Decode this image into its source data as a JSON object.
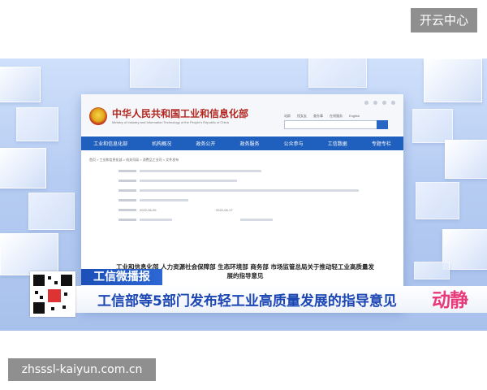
{
  "badge": {
    "label": "开云中心"
  },
  "document": {
    "ministry_title": "中华人民共和国工业和信息化部",
    "ministry_subtitle": "Ministry of Industry and Information Technology of the People's Republic of China",
    "top_links": [
      "站群",
      "找女友",
      "查办事",
      "在线服务",
      "English"
    ],
    "nav": [
      "工业和信息化部",
      "机构概况",
      "政务公开",
      "政务服务",
      "公众参与",
      "工信数据",
      "专题专栏"
    ],
    "breadcrumb": "首页 > 工业和信息化部 > 机关司局 > 消费品工业司 > 文件发布",
    "date_issued": "2022-06-09",
    "date_published": "2022-06-17",
    "headline": "工业和信息化部 人力资源社会保障部 生态环境部 商务部 市场监管总局关于推动轻工业高质量发展的指导意见",
    "doc_number": "工信部联消费〔2022〕68号"
  },
  "broadcast": {
    "program_label": "工信微播报",
    "ticker": "工信部等5部门发布轻工业高质量发展的指导意见",
    "logo": "动静"
  },
  "watermark": {
    "text": "zhsssl-kaiyun.com.cn"
  },
  "colors": {
    "accent_blue": "#1f5fbe",
    "ministry_red": "#b3261e",
    "logo_pink": "#e83a7a",
    "badge_gray": "#8f8f8f"
  }
}
